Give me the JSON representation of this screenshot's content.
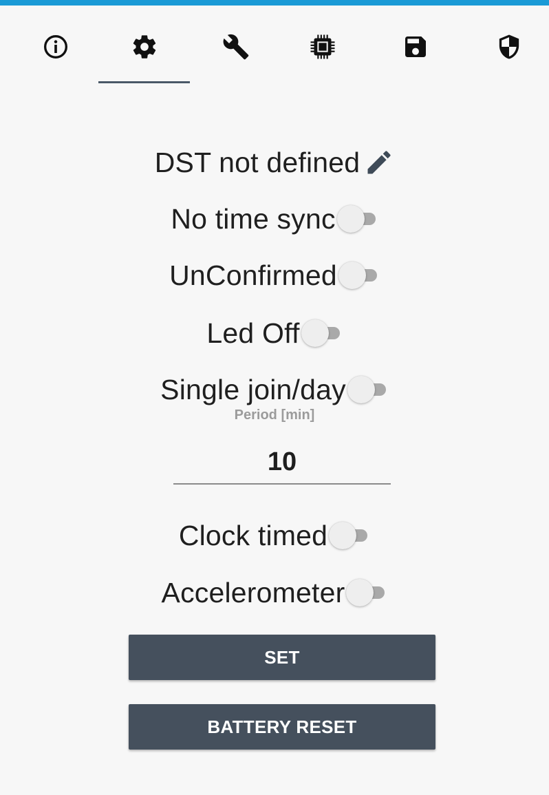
{
  "colors": {
    "accent_bar": "#1a9ad6",
    "tab_underline": "#4a5968",
    "button_bg": "#45505d",
    "button_text": "#ffffff",
    "background": "#f7f7f7",
    "switch_track_off": "#a9a9a9",
    "switch_thumb_off": "#eeeeee"
  },
  "tabs": [
    {
      "icon": "info-icon",
      "selected": false
    },
    {
      "icon": "gear-icon",
      "selected": true
    },
    {
      "icon": "wrench-icon",
      "selected": false
    },
    {
      "icon": "chip-icon",
      "selected": false
    },
    {
      "icon": "save-icon",
      "selected": false
    },
    {
      "icon": "shield-icon",
      "selected": false
    }
  ],
  "settings": {
    "dst": {
      "label": "DST not defined",
      "icon": "pencil-icon"
    },
    "toggles": [
      {
        "label": "No time sync",
        "on": false
      },
      {
        "label": "UnConfirmed",
        "on": false
      },
      {
        "label": "Led Off",
        "on": false
      },
      {
        "label": "Single join/day",
        "on": false
      },
      {
        "label": "Clock timed",
        "on": false
      },
      {
        "label": "Accelerometer",
        "on": false
      }
    ],
    "period": {
      "label": "Period [min]",
      "value": "10"
    }
  },
  "buttons": {
    "set": "SET",
    "battery_reset": "BATTERY RESET"
  }
}
